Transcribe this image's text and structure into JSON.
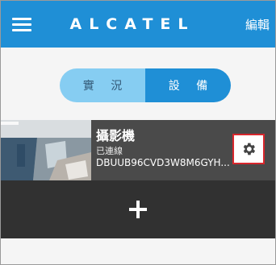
{
  "colors": {
    "brand": "#1f8fd6",
    "segment_inactive": "#86cdf2",
    "card_background": "#4a4a4a",
    "add_row_background": "#313131",
    "highlight_border": "#d8262c"
  },
  "header": {
    "menu_icon": "hamburger-menu-icon",
    "title": "ALCATEL",
    "edit_label": "編輯"
  },
  "tabs": [
    {
      "label": "實 況",
      "selected": false
    },
    {
      "label": "設 備",
      "selected": true
    }
  ],
  "devices": [
    {
      "name": "攝影機",
      "status": "已連線",
      "id": "DBUUB96CVD3W8M6GYH...",
      "settings_icon": "gear-icon"
    }
  ],
  "add_device_icon": "plus-icon"
}
